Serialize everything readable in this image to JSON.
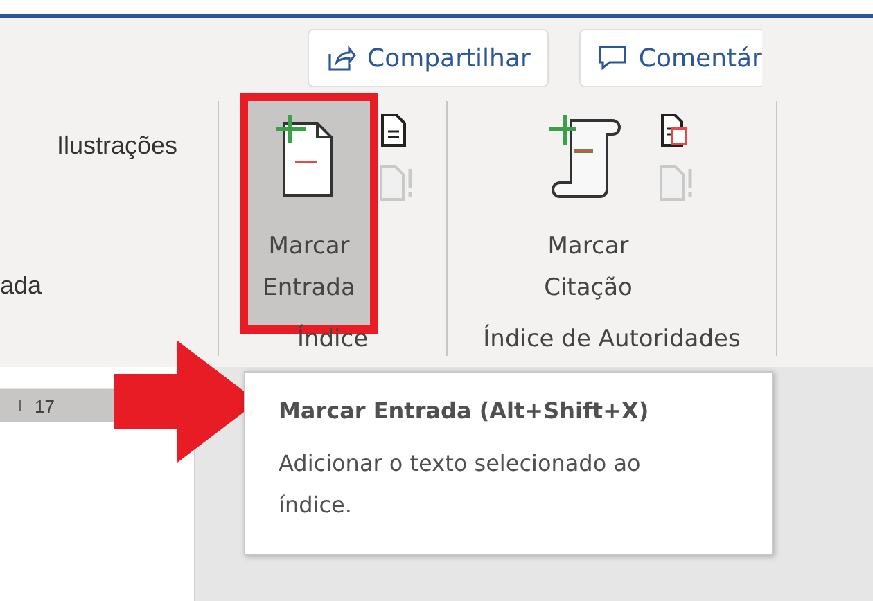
{
  "header_buttons": [
    {
      "label": "Compartilhar",
      "kind": "share"
    },
    {
      "label": "Comentár",
      "kind": "comment"
    }
  ],
  "ribbon": {
    "partial_group": {
      "items": [
        "Ilustrações",
        "ada"
      ]
    },
    "groups": [
      {
        "label": "Índice",
        "big_button": {
          "lines": [
            "Marcar",
            "Entrada"
          ],
          "kind": "entry",
          "selected": true
        },
        "small_buttons": [
          {
            "kind": "insert",
            "disabled": false
          },
          {
            "kind": "update",
            "disabled": true
          }
        ]
      },
      {
        "label": "Índice de Autoridades",
        "big_button": {
          "lines": [
            "Marcar",
            "Citação"
          ],
          "kind": "citation",
          "selected": false
        },
        "small_buttons": [
          {
            "kind": "insert-table",
            "disabled": false
          },
          {
            "kind": "update",
            "disabled": true
          }
        ]
      }
    ]
  },
  "ruler": {
    "number": "17"
  },
  "tooltip": {
    "title": "Marcar Entrada (Alt+Shift+X)",
    "description": "Adicionar o texto selecionado ao índice."
  }
}
